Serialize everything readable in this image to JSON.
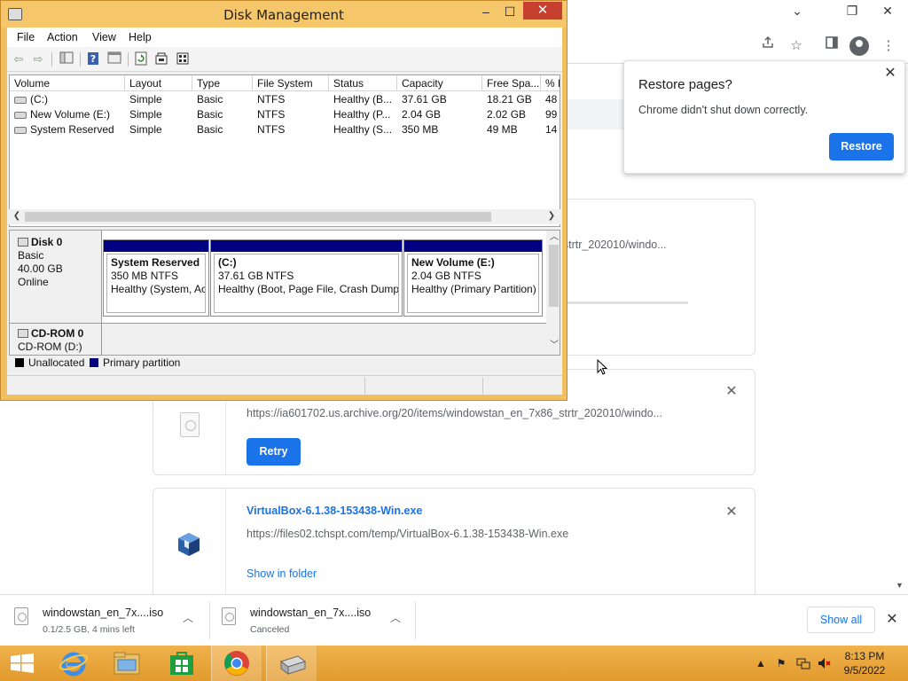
{
  "chrome": {
    "controls": {
      "minimize": "⌄",
      "restore": "❐",
      "close": "✕"
    },
    "toolbar_icons": [
      "share-icon",
      "star-icon",
      "sidebar-icon",
      "profile-icon",
      "menu-icon"
    ],
    "restore_popup": {
      "title": "Restore pages?",
      "message": "Chrome didn't shut down correctly.",
      "button": "Restore"
    },
    "downloads": [
      {
        "url_partial": "6_strtr_202010/windo...",
        "state": "in-progress"
      },
      {
        "url": "https://ia601702.us.archive.org/20/items/windowstan_en_7x86_strtr_202010/windo...",
        "action": "Retry"
      },
      {
        "name": "VirtualBox-6.1.38-153438-Win.exe",
        "url": "https://files02.tchspt.com/temp/VirtualBox-6.1.38-153438-Win.exe",
        "action": "Show in folder"
      }
    ],
    "shelf": {
      "items": [
        {
          "name": "windowstan_en_7x....iso",
          "status": "0.1/2.5 GB, 4 mins left"
        },
        {
          "name": "windowstan_en_7x....iso",
          "status": "Canceled"
        }
      ],
      "show_all": "Show all"
    }
  },
  "disk_mgmt": {
    "title": "Disk Management",
    "menu": [
      "File",
      "Action",
      "View",
      "Help"
    ],
    "columns": [
      "Volume",
      "Layout",
      "Type",
      "File System",
      "Status",
      "Capacity",
      "Free Spa...",
      "% F"
    ],
    "volumes": [
      {
        "volume": "(C:)",
        "layout": "Simple",
        "type": "Basic",
        "fs": "NTFS",
        "status": "Healthy (B...",
        "capacity": "37.61 GB",
        "free": "18.21 GB",
        "pct": "48"
      },
      {
        "volume": "New Volume (E:)",
        "layout": "Simple",
        "type": "Basic",
        "fs": "NTFS",
        "status": "Healthy (P...",
        "capacity": "2.04 GB",
        "free": "2.02 GB",
        "pct": "99"
      },
      {
        "volume": "System Reserved",
        "layout": "Simple",
        "type": "Basic",
        "fs": "NTFS",
        "status": "Healthy (S...",
        "capacity": "350 MB",
        "free": "49 MB",
        "pct": "14"
      }
    ],
    "disk0": {
      "name": "Disk 0",
      "kind": "Basic",
      "size": "40.00 GB",
      "state": "Online",
      "partitions": [
        {
          "name": "System Reserved",
          "size": "350 MB NTFS",
          "status": "Healthy (System, Ac"
        },
        {
          "name": "(C:)",
          "size": "37.61 GB NTFS",
          "status": "Healthy (Boot, Page File, Crash Dump,"
        },
        {
          "name": "New Volume  (E:)",
          "size": "2.04 GB NTFS",
          "status": "Healthy (Primary Partition)"
        }
      ]
    },
    "cdrom": {
      "name": "CD-ROM 0",
      "sub": "CD-ROM (D:)"
    },
    "legend": {
      "unallocated": "Unallocated",
      "primary": "Primary partition",
      "unallocated_color": "#000000",
      "primary_color": "#000080"
    }
  },
  "taskbar": {
    "apps": [
      "start-button",
      "internet-explorer",
      "file-explorer",
      "windows-store",
      "chrome",
      "disk-management"
    ],
    "clock": {
      "time": "8:13 PM",
      "date": "9/5/2022"
    }
  }
}
